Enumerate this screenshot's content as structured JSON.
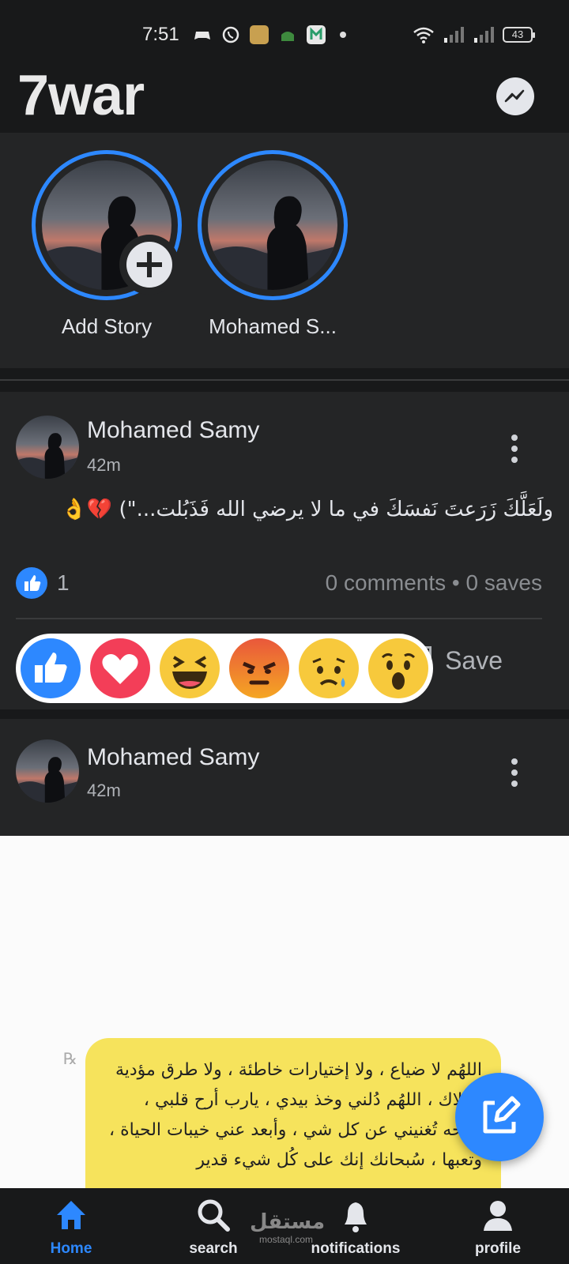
{
  "status_bar": {
    "time": "7:51",
    "battery": "43",
    "icons": [
      "game-controller-icon",
      "whatsapp-icon",
      "app-icon",
      "mosque-icon",
      "maps-icon",
      "dot-icon",
      "wifi-icon",
      "signal-icon",
      "signal-icon",
      "battery-icon"
    ]
  },
  "header": {
    "app_title": "7war",
    "action_icon": "messenger-icon"
  },
  "stories": [
    {
      "label": "Add Story",
      "has_add_button": true
    },
    {
      "label": "Mohamed S..."
    }
  ],
  "posts": [
    {
      "author": "Mohamed Samy",
      "time": "42m",
      "text": "ولَعَلَّكَ زَرَعتَ نَفسَكَ في ما لا يرضي الله فَذَبُلت...\") 💔👌",
      "like_count": "1",
      "meta": "0 comments • 0 saves",
      "save_label": "Save",
      "reactions": [
        "like",
        "love",
        "haha",
        "angry",
        "sad",
        "wow"
      ]
    },
    {
      "author": "Mohamed Samy",
      "time": "42m",
      "image_text": "اللهُم لا ضياع ، ولا إختيارات خاطئة ، ولا طرق مؤدية للهلاك ، اللهُم دُلني وخذ بيدي ، يارب أرح قلبي ، براحه تُغنيني عن كل شي ، وأبعد عني خيبات الحياة ، وتعبها ، سُبحانك إنك على كُل شيء قدير"
    }
  ],
  "fab": {
    "icon": "edit-icon"
  },
  "watermark": {
    "main": "مستقل",
    "sub": "mostaql.com"
  },
  "bottom_nav": [
    {
      "label": "Home",
      "icon": "home-icon",
      "active": true
    },
    {
      "label": "search",
      "icon": "search-icon"
    },
    {
      "label": "notifications",
      "icon": "bell-icon"
    },
    {
      "label": "profile",
      "icon": "person-icon"
    }
  ],
  "colors": {
    "accent": "#2d88ff",
    "background": "#18191a",
    "surface": "#242526",
    "text": "#e4e6eb",
    "muted": "#b0b3b8"
  }
}
